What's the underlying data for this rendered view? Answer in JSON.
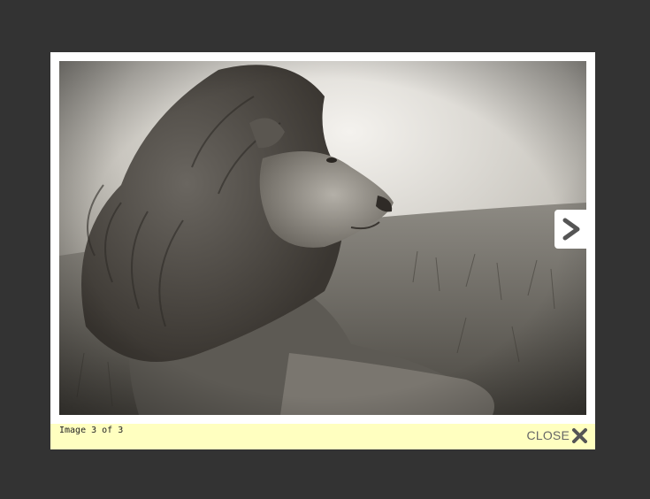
{
  "lightbox": {
    "image_alt": "lion portrait",
    "caption": "Image 3 of 3",
    "current_index": 3,
    "total": 3,
    "close_label": "CLOSE",
    "next_icon": "chevron-right-icon",
    "close_icon": "close-x-icon"
  },
  "colors": {
    "overlay": "#333333",
    "frame": "#ffffff",
    "caption_bar": "#ffffc0",
    "close_text": "#666666"
  }
}
